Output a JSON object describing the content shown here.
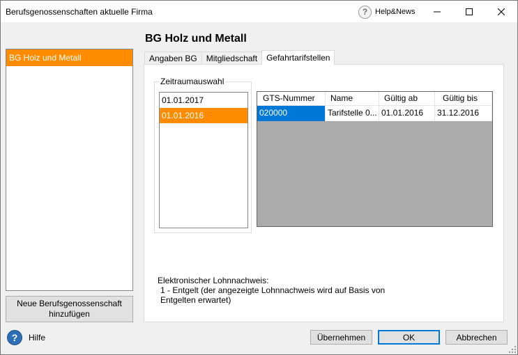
{
  "window": {
    "title": "Berufsgenossenschaften aktuelle Firma",
    "help_news_label": "Help&News",
    "help_news_icon": "?"
  },
  "sidebar": {
    "items": [
      "BG Holz und Metall"
    ],
    "selected_index": 0,
    "new_button_label": "Neue Berufsgenossenschaft hinzufügen"
  },
  "main": {
    "title": "BG Holz und Metall",
    "tabs": [
      {
        "label": "Angaben BG",
        "active": false
      },
      {
        "label": "Mitgliedschaft",
        "active": false
      },
      {
        "label": "Gefahrtarifstellen",
        "active": true
      }
    ],
    "period_group": {
      "title": "Zeitraumauswahl",
      "dates": [
        "01.01.2017",
        "01.01.2016"
      ],
      "selected_index": 1
    },
    "grid": {
      "columns": [
        "GTS-Nummer",
        "Name",
        "Gültig ab",
        "Gültig bis"
      ],
      "rows": [
        [
          "020000",
          "Tarifstelle 0...",
          "01.01.2016",
          "31.12.2016"
        ]
      ]
    },
    "electronic_wage": {
      "label": "Elektronischer Lohnnachweis:",
      "value": "1 - Entgelt (der angezeigte Lohnnachweis wird auf Basis von Entgelten erwartet)"
    }
  },
  "footer": {
    "help_label": "Hilfe",
    "help_icon": "?",
    "apply_label": "Übernehmen",
    "ok_label": "OK",
    "cancel_label": "Abbrechen"
  },
  "colors": {
    "selection_orange": "#ff8c00",
    "selection_blue": "#0078d7"
  }
}
